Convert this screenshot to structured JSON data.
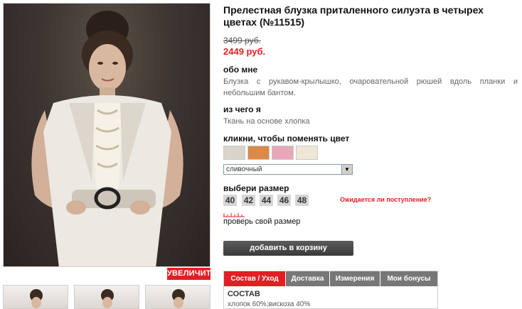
{
  "product": {
    "title": "Прелестная блузка приталенного силуэта в четырех цветах (№11515)",
    "old_price": "3499 руб.",
    "new_price": "2449 руб."
  },
  "about": {
    "heading": "обо мне",
    "text": "Блузка с рукавом-крылышко, очаровательной рюшей вдоль планки и небольшим бантом."
  },
  "material": {
    "heading": "из чего я",
    "text": "Ткань на основе хлопка"
  },
  "color": {
    "heading": "кликни, чтобы поменять цвет",
    "swatches": [
      {
        "name": "grey-cream",
        "color": "#d9d5cc"
      },
      {
        "name": "orange",
        "color": "#d98a4a"
      },
      {
        "name": "pink",
        "color": "#e8a7b8"
      },
      {
        "name": "cream",
        "color": "#efe6d6"
      }
    ],
    "selected": "сливочный"
  },
  "size": {
    "heading": "выбери размер",
    "options": [
      "40",
      "42",
      "44",
      "46",
      "48"
    ],
    "expected_link": "Ожидается ли поступление?",
    "check_link": "проверь свой размер"
  },
  "actions": {
    "add_to_cart": "добавить в корзину",
    "zoom": "УВЕЛИЧИТЬ"
  },
  "tabs": {
    "items": [
      "Состав / Уход",
      "Доставка",
      "Измерения",
      "Мои бонусы"
    ],
    "active": 0,
    "content_title": "СОСТАВ",
    "content_text": "хлопок 60%;вискоза 40%"
  },
  "colors": {
    "accent": "#e31e24",
    "button_dark": "#444444",
    "tab_inactive": "#777777"
  }
}
